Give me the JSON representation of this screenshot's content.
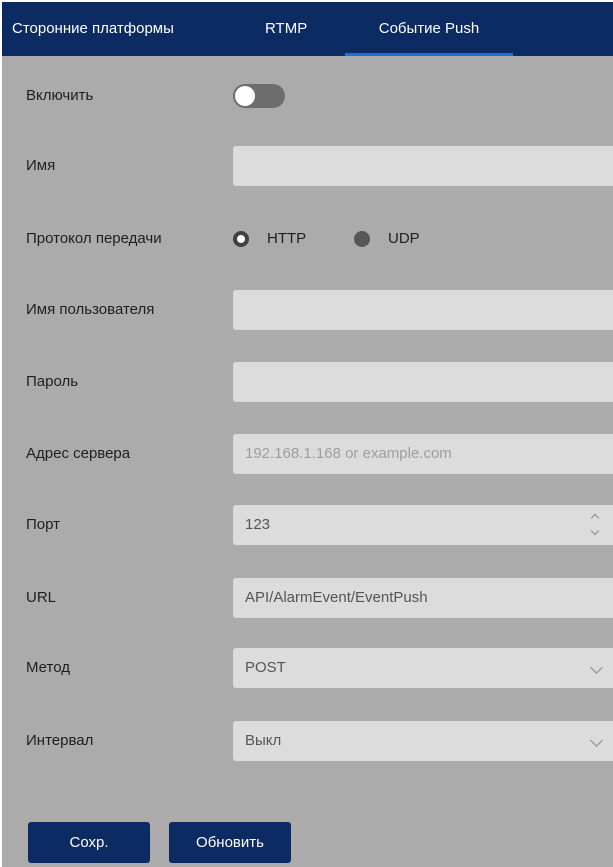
{
  "tabs": [
    {
      "label": "Сторонние платформы",
      "active": false
    },
    {
      "label": "RTMP",
      "active": false
    },
    {
      "label": "Событие Push",
      "active": true
    }
  ],
  "form": {
    "enable": {
      "label": "Включить",
      "value": false
    },
    "name": {
      "label": "Имя",
      "value": ""
    },
    "protocol": {
      "label": "Протокол передачи",
      "options": [
        "HTTP",
        "UDP"
      ],
      "selected": "HTTP"
    },
    "username": {
      "label": "Имя пользователя",
      "value": ""
    },
    "password": {
      "label": "Пароль",
      "value": ""
    },
    "server": {
      "label": "Адрес сервера",
      "value": "",
      "placeholder": "192.168.1.168 or example.com"
    },
    "port": {
      "label": "Порт",
      "value": "123"
    },
    "url": {
      "label": "URL",
      "value": "API/AlarmEvent/EventPush"
    },
    "method": {
      "label": "Метод",
      "value": "POST"
    },
    "interval": {
      "label": "Интервал",
      "value": "Выкл"
    }
  },
  "buttons": {
    "save": "Сохр.",
    "refresh": "Обновить"
  },
  "colors": {
    "header": "#0d2b63",
    "active_tab_underline": "#1e6fd9",
    "background": "#ababab",
    "field": "#dcdcdc",
    "button": "#0d2b63"
  }
}
